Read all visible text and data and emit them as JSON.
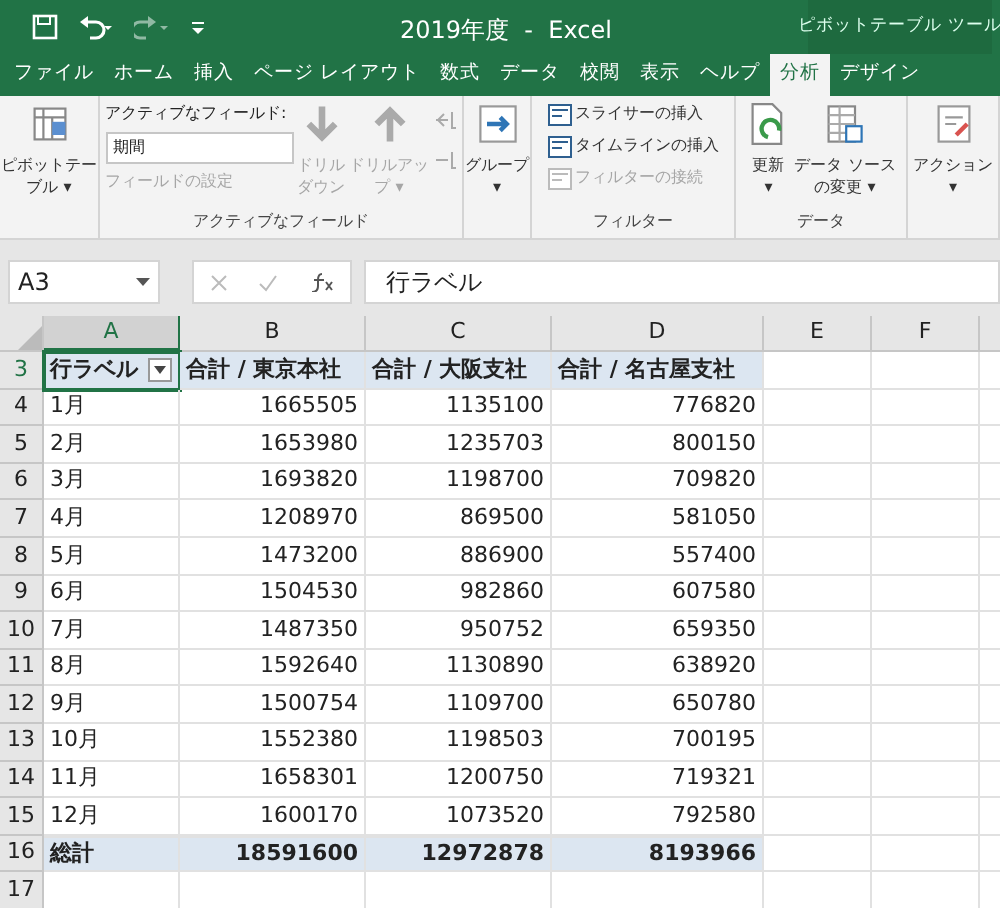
{
  "window": {
    "title": "2019年度  -  Excel",
    "context_label": "ピボットテーブル ツール"
  },
  "tabs": [
    {
      "label": "ファイル",
      "selected": false
    },
    {
      "label": "ホーム",
      "selected": false
    },
    {
      "label": "挿入",
      "selected": false
    },
    {
      "label": "ページ レイアウト",
      "selected": false
    },
    {
      "label": "数式",
      "selected": false
    },
    {
      "label": "データ",
      "selected": false
    },
    {
      "label": "校閲",
      "selected": false
    },
    {
      "label": "表示",
      "selected": false
    },
    {
      "label": "ヘルプ",
      "selected": false
    },
    {
      "label": "分析",
      "selected": true
    },
    {
      "label": "デザイン",
      "selected": false
    }
  ],
  "ribbon": {
    "groups": [
      {
        "items": [
          {
            "kind": "large",
            "label": "ピボットテー",
            "label2": "ブル ▾",
            "disabled": false
          }
        ]
      },
      {
        "label": "アクティブなフィールド",
        "items": [
          {
            "kind": "field",
            "caption": "アクティブなフィールド:",
            "value": "期間",
            "setting": "フィールドの設定",
            "disabled": true
          },
          {
            "kind": "large",
            "label": "ドリル",
            "label2": "ダウン",
            "disabled": true
          },
          {
            "kind": "large",
            "label": "ドリルアッ",
            "label2": "プ ▾",
            "disabled": true
          },
          {
            "kind": "mini",
            "disabled": true
          }
        ]
      },
      {
        "items": [
          {
            "kind": "large",
            "label": "グループ",
            "label2": "▾",
            "disabled": false
          }
        ]
      },
      {
        "label": "フィルター",
        "items": [
          {
            "kind": "smalls",
            "entries": [
              {
                "label": "スライサーの挿入",
                "disabled": false
              },
              {
                "label": "タイムラインの挿入",
                "disabled": false
              },
              {
                "label": "フィルターの接続",
                "disabled": true
              }
            ]
          }
        ]
      },
      {
        "label": "データ",
        "items": [
          {
            "kind": "large",
            "label": "更新",
            "label2": "▾",
            "disabled": false
          },
          {
            "kind": "large",
            "label": "データ ソース",
            "label2": "の変更 ▾",
            "disabled": false
          }
        ]
      },
      {
        "items": [
          {
            "kind": "large",
            "label": "アクション",
            "label2": "▾",
            "disabled": false
          }
        ]
      }
    ]
  },
  "formula_bar": {
    "name_box": "A3",
    "formula": "行ラベル"
  },
  "sheet": {
    "columns": [
      {
        "label": "A",
        "selected": true
      },
      {
        "label": "B",
        "selected": false
      },
      {
        "label": "C",
        "selected": false
      },
      {
        "label": "D",
        "selected": false
      },
      {
        "label": "E",
        "selected": false
      },
      {
        "label": "F",
        "selected": false
      }
    ],
    "rows": [
      {
        "number": "3",
        "kind": "header",
        "cells": [
          "行ラベル",
          "合計 / 東京本社",
          "合計 / 大阪支社",
          "合計 / 名古屋支社"
        ]
      },
      {
        "number": "4",
        "kind": "data",
        "cells": [
          "1月",
          "1665505",
          "1135100",
          "776820"
        ]
      },
      {
        "number": "5",
        "kind": "data",
        "cells": [
          "2月",
          "1653980",
          "1235703",
          "800150"
        ]
      },
      {
        "number": "6",
        "kind": "data",
        "cells": [
          "3月",
          "1693820",
          "1198700",
          "709820"
        ]
      },
      {
        "number": "7",
        "kind": "data",
        "cells": [
          "4月",
          "1208970",
          "869500",
          "581050"
        ]
      },
      {
        "number": "8",
        "kind": "data",
        "cells": [
          "5月",
          "1473200",
          "886900",
          "557400"
        ]
      },
      {
        "number": "9",
        "kind": "data",
        "cells": [
          "6月",
          "1504530",
          "982860",
          "607580"
        ]
      },
      {
        "number": "10",
        "kind": "data",
        "cells": [
          "7月",
          "1487350",
          "950752",
          "659350"
        ]
      },
      {
        "number": "11",
        "kind": "data",
        "cells": [
          "8月",
          "1592640",
          "1130890",
          "638920"
        ]
      },
      {
        "number": "12",
        "kind": "data",
        "cells": [
          "9月",
          "1500754",
          "1109700",
          "650780"
        ]
      },
      {
        "number": "13",
        "kind": "data",
        "cells": [
          "10月",
          "1552380",
          "1198503",
          "700195"
        ]
      },
      {
        "number": "14",
        "kind": "data",
        "cells": [
          "11月",
          "1658301",
          "1200750",
          "719321"
        ]
      },
      {
        "number": "15",
        "kind": "data",
        "cells": [
          "12月",
          "1600170",
          "1073520",
          "792580"
        ]
      },
      {
        "number": "16",
        "kind": "total",
        "cells": [
          "総計",
          "18591600",
          "12972878",
          "8193966"
        ]
      },
      {
        "number": "17",
        "kind": "empty",
        "cells": []
      }
    ]
  }
}
